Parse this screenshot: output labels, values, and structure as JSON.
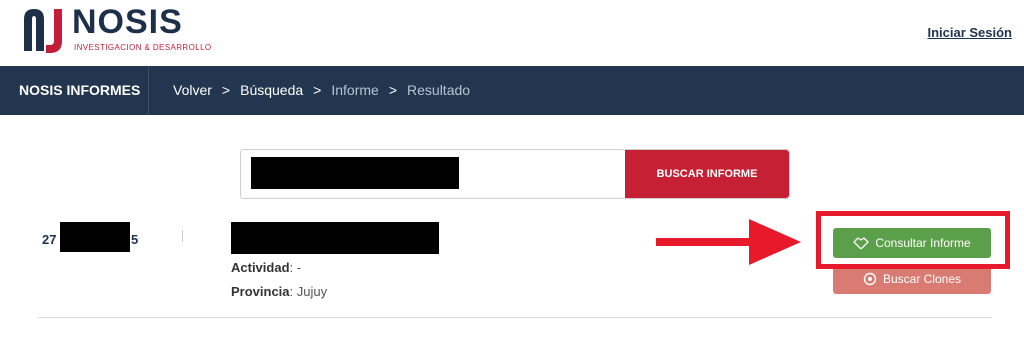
{
  "header": {
    "logo_word": "NOSIS",
    "logo_subtitle": "INVESTIGACION & DESARROLLO",
    "login_link": "Iniciar Sesión"
  },
  "navbar": {
    "title": "NOSIS INFORMES",
    "breadcrumbs": [
      "Volver",
      "Búsqueda",
      "Informe",
      "Resultado"
    ],
    "separator": ">"
  },
  "search": {
    "value": "",
    "button_label": "BUSCAR INFORME"
  },
  "result": {
    "cuit_prefix": "27",
    "cuit_suffix": "5",
    "activity_label": "Actividad",
    "activity_value": ": -",
    "province_label": "Provincia",
    "province_value": ": Jujuy"
  },
  "actions": {
    "consultar_label": "Consultar Informe",
    "clones_label": "Buscar Clones"
  },
  "colors": {
    "navbar": "#22374f",
    "brand_red": "#c52033",
    "consultar_green": "#5c9f4a",
    "highlight_red": "#e8192a"
  }
}
